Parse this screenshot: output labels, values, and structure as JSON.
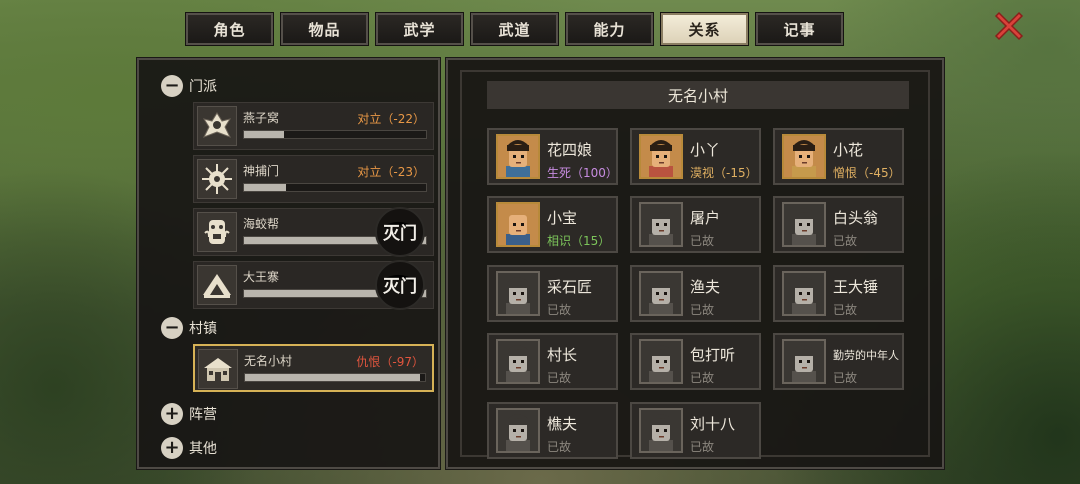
{
  "tabs": [
    {
      "label": "角色",
      "active": false
    },
    {
      "label": "物品",
      "active": false
    },
    {
      "label": "武学",
      "active": false
    },
    {
      "label": "武道",
      "active": false
    },
    {
      "label": "能力",
      "active": false
    },
    {
      "label": "关系",
      "active": true
    },
    {
      "label": "记事",
      "active": false
    }
  ],
  "close_icon": "close-x-icon",
  "colors": {
    "close": "#d9413a",
    "hostile": "#e0553e",
    "opposed": "#e99846",
    "sworn": "#c78ce0",
    "acquainted": "#7cc45a",
    "disdain": "#e0b062",
    "deceased": "#8c877f",
    "selected_border": "#d6b256"
  },
  "groups": {
    "sect": {
      "label": "门派",
      "expanded": true,
      "icon": "minus-icon"
    },
    "town": {
      "label": "村镇",
      "expanded": true,
      "icon": "minus-icon"
    },
    "camp": {
      "label": "阵营",
      "expanded": false,
      "icon": "plus-icon"
    },
    "other": {
      "label": "其他",
      "expanded": false,
      "icon": "plus-icon"
    }
  },
  "factions": [
    {
      "name": "燕子窝",
      "relation": "对立（-22）",
      "fill": 0.22,
      "destroyed": false,
      "icon": "swallow-nest-emblem-icon"
    },
    {
      "name": "神捕门",
      "relation": "对立（-23）",
      "fill": 0.23,
      "destroyed": false,
      "icon": "sun-emblem-icon"
    },
    {
      "name": "海蛟帮",
      "relation": "",
      "fill": 1.0,
      "destroyed": true,
      "stamp": "灭门",
      "icon": "sea-serpent-emblem-icon"
    },
    {
      "name": "大王寨",
      "relation": "",
      "fill": 1.0,
      "destroyed": true,
      "stamp": "灭门",
      "icon": "mountain-fort-emblem-icon"
    }
  ],
  "towns": [
    {
      "name": "无名小村",
      "relation": "仇恨（-97）",
      "fill": 0.97,
      "selected": true,
      "icon": "village-house-icon"
    }
  ],
  "village_title": "无名小村",
  "npcs": [
    {
      "name": "花四娘",
      "status": "生死（100）",
      "state": "sworn",
      "icon": "woman-portrait-icon"
    },
    {
      "name": "小丫",
      "status": "漠视（-15）",
      "state": "disdain",
      "icon": "girl-portrait-icon"
    },
    {
      "name": "小花",
      "status": "憎恨（-45）",
      "state": "disdain",
      "icon": "girl-bun-portrait-icon"
    },
    {
      "name": "小宝",
      "status": "相识（15）",
      "state": "acquainted",
      "icon": "bald-boy-portrait-icon"
    },
    {
      "name": "屠户",
      "status": "已故",
      "state": "deceased",
      "icon": "butcher-portrait-icon"
    },
    {
      "name": "白头翁",
      "status": "已故",
      "state": "deceased",
      "icon": "old-man-portrait-icon"
    },
    {
      "name": "采石匠",
      "status": "已故",
      "state": "deceased",
      "icon": "stonemason-portrait-icon"
    },
    {
      "name": "渔夫",
      "status": "已故",
      "state": "deceased",
      "icon": "fisherman-portrait-icon"
    },
    {
      "name": "王大锤",
      "status": "已故",
      "state": "deceased",
      "icon": "blacksmith-portrait-icon"
    },
    {
      "name": "村长",
      "status": "已故",
      "state": "deceased",
      "icon": "village-chief-portrait-icon"
    },
    {
      "name": "包打听",
      "status": "已故",
      "state": "deceased",
      "icon": "informant-portrait-icon"
    },
    {
      "name": "勤劳的中年人",
      "status": "已故",
      "state": "deceased",
      "icon": "middle-aged-man-portrait-icon"
    },
    {
      "name": "樵夫",
      "status": "已故",
      "state": "deceased",
      "icon": "woodcutter-portrait-icon"
    },
    {
      "name": "刘十八",
      "status": "已故",
      "state": "deceased",
      "icon": "bandaged-man-portrait-icon"
    }
  ]
}
